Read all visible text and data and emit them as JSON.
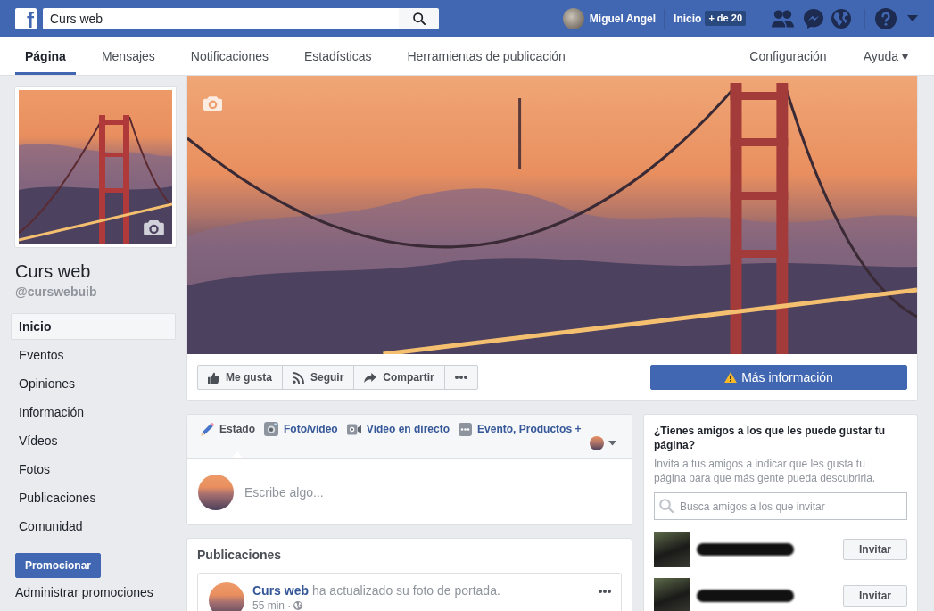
{
  "top_bar": {
    "logo": "f",
    "search": {
      "value": "Curs web"
    },
    "user_name": "Miguel Angel",
    "home_link": "Inicio",
    "home_badge": "+ de 20"
  },
  "nav": {
    "tabs": [
      {
        "label": "Página",
        "selected": true
      },
      {
        "label": "Mensajes",
        "selected": false
      },
      {
        "label": "Notificaciones",
        "selected": false
      },
      {
        "label": "Estadísticas",
        "selected": false
      },
      {
        "label": "Herramientas de publicación",
        "selected": false
      }
    ],
    "right_links": [
      {
        "label": "Configuración"
      },
      {
        "label": "Ayuda ▾"
      }
    ]
  },
  "sidebar": {
    "page_name": "Curs web",
    "handle": "@curswebuib",
    "items": [
      {
        "label": "Inicio",
        "selected": true
      },
      {
        "label": "Eventos",
        "selected": false
      },
      {
        "label": "Opiniones",
        "selected": false
      },
      {
        "label": "Información",
        "selected": false
      },
      {
        "label": "Vídeos",
        "selected": false
      },
      {
        "label": "Fotos",
        "selected": false
      },
      {
        "label": "Publicaciones",
        "selected": false
      },
      {
        "label": "Comunidad",
        "selected": false
      }
    ],
    "promote_button": "Promocionar",
    "manage_link": "Administrar promociones"
  },
  "page_actions": {
    "buttons": [
      {
        "kind": "like",
        "label": "Me gusta"
      },
      {
        "kind": "follow",
        "label": "Seguir"
      },
      {
        "kind": "share",
        "label": "Compartir"
      },
      {
        "kind": "more"
      }
    ],
    "info_button": "Más información"
  },
  "composer": {
    "tabs": [
      {
        "kind": "status",
        "label": "Estado",
        "selected": true
      },
      {
        "kind": "photo",
        "label": "Foto/vídeo",
        "selected": false
      },
      {
        "kind": "live",
        "label": "Vídeo en directo",
        "selected": false
      },
      {
        "kind": "event",
        "label": "Evento, Productos +",
        "selected": false
      }
    ],
    "placeholder": "Escribe algo..."
  },
  "posts": {
    "title": "Publicaciones",
    "items": [
      {
        "author": "Curs web",
        "text": "ha actualizado su foto de portada.",
        "time": "55 min ·"
      }
    ]
  },
  "invite": {
    "title": "¿Tienes amigos a los que les puede gustar tu página?",
    "description": "Invita a tus amigos a indicar que les gusta tu página para que más gente pueda descubrirla.",
    "search": {
      "placeholder": "Busca amigos a los que invitar"
    },
    "friends": [
      {
        "button": "Invitar"
      },
      {
        "button": "Invitar"
      }
    ]
  }
}
